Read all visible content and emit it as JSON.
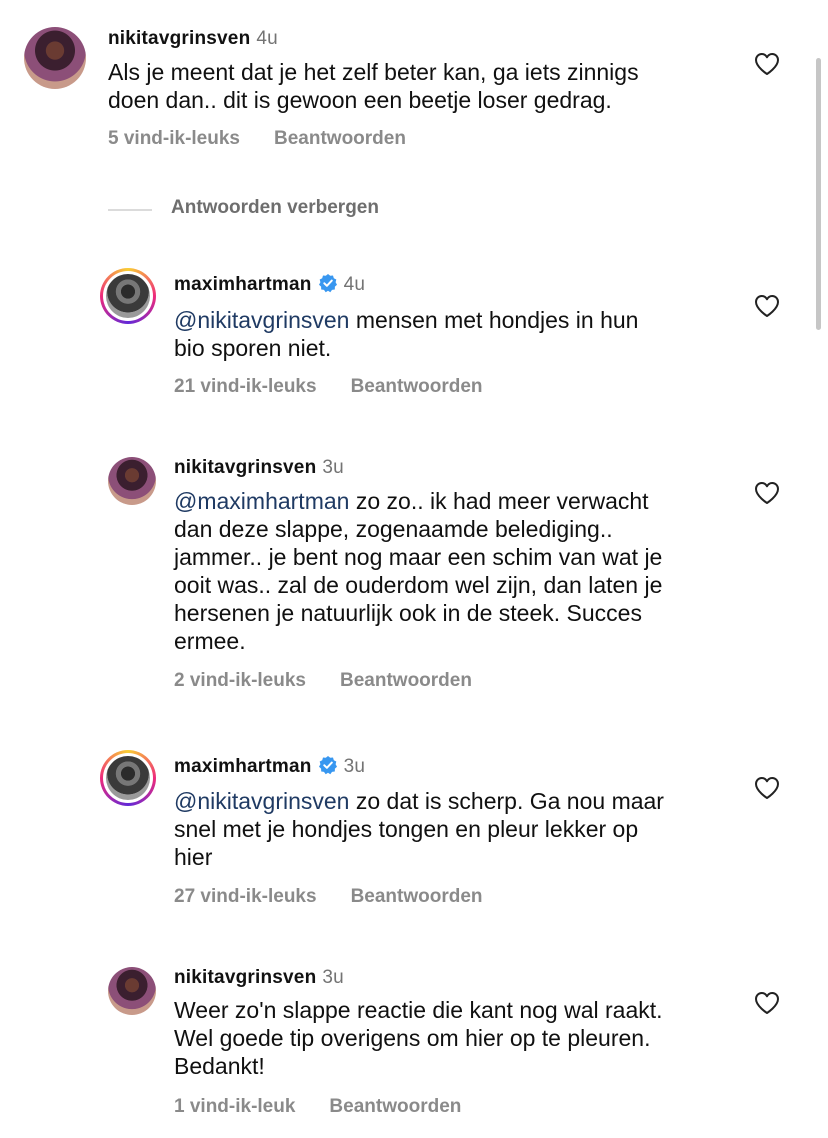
{
  "comments": [
    {
      "username": "nikitavgrinsven",
      "time": "4u",
      "mention": "",
      "text": "Als je meent dat je het zelf beter kan, ga iets zinnigs\ndoen dan.. dit is gewoon een beetje loser gedrag.",
      "likes": "5 vind-ik-leuks",
      "reply": "Beantwoorden"
    },
    {
      "username": "maximhartman",
      "time": "4u",
      "mention": "@nikitavgrinsven",
      "text": " mensen met hondjes in hun\nbio sporen niet.",
      "likes": "21 vind-ik-leuks",
      "reply": "Beantwoorden"
    },
    {
      "username": "nikitavgrinsven",
      "time": "3u",
      "mention": "@maximhartman",
      "text": " zo zo.. ik had meer verwacht\ndan deze slappe, zogenaamde belediging..\njammer.. je bent nog maar een schim van wat je\nooit was.. zal de ouderdom wel zijn, dan laten je\nhersenen je natuurlijk ook in de steek. Succes\nermee.",
      "likes": "2 vind-ik-leuks",
      "reply": "Beantwoorden"
    },
    {
      "username": "maximhartman",
      "time": "3u",
      "mention": "@nikitavgrinsven",
      "text": " zo dat is scherp. Ga nou maar\nsnel met je hondjes tongen en pleur lekker op\nhier",
      "likes": "27 vind-ik-leuks",
      "reply": "Beantwoorden"
    },
    {
      "username": "nikitavgrinsven",
      "time": "3u",
      "mention": "",
      "text": "Weer zo'n slappe reactie die kant nog wal raakt.\nWel goede tip overigens om hier op te pleuren.\nBedankt!",
      "likes": "1 vind-ik-leuk",
      "reply": "Beantwoorden"
    }
  ],
  "hide_replies_label": "Antwoorden verbergen",
  "icons": {
    "like": "heart-outline-icon",
    "verified": "verified-badge-icon"
  },
  "colors": {
    "mention": "#1f3a63",
    "verified": "#3897f0",
    "secondary_text": "#8a8a8a"
  }
}
